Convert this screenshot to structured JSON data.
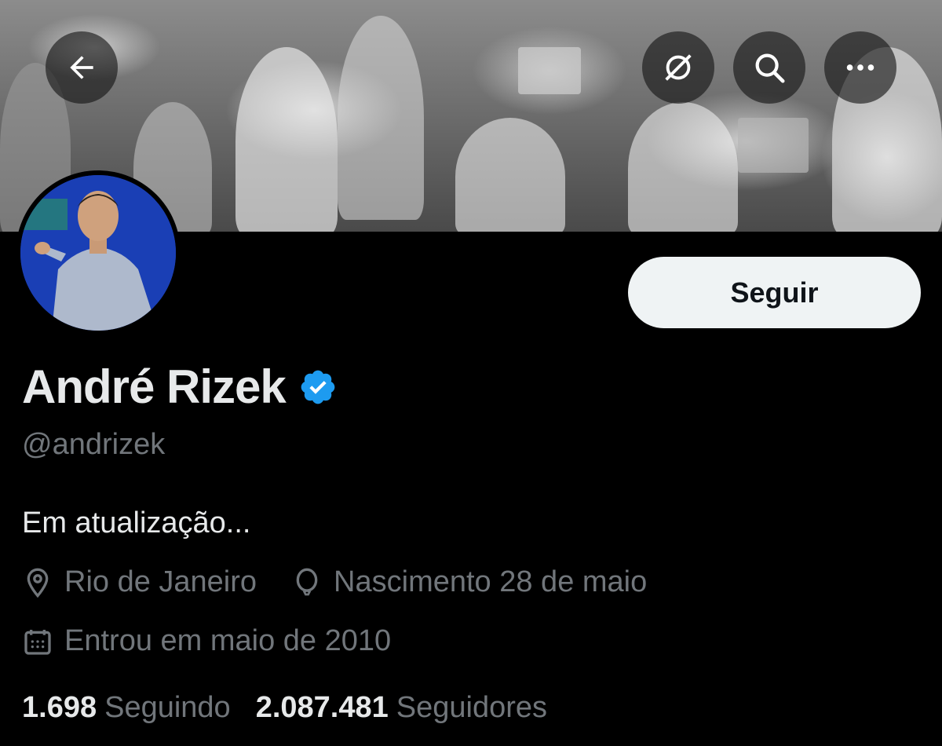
{
  "header": {
    "back_icon": "arrow-left-icon",
    "actions": [
      "mute-icon",
      "search-icon",
      "more-icon"
    ]
  },
  "profile": {
    "display_name": "André Rizek",
    "verified_color": "#1d9bf0",
    "handle": "@andrizek",
    "bio": "Em atualização...",
    "location": "Rio de Janeiro",
    "birthday": "Nascimento 28 de maio",
    "joined": "Entrou em maio de 2010",
    "follow_label": "Seguir"
  },
  "stats": {
    "following_count": "1.698",
    "following_label": "Seguindo",
    "followers_count": "2.087.481",
    "followers_label": "Seguidores"
  },
  "colors": {
    "background": "#000000",
    "primary_text": "#e7e9ea",
    "secondary_text": "#71767b",
    "button_bg": "#eff3f4"
  }
}
